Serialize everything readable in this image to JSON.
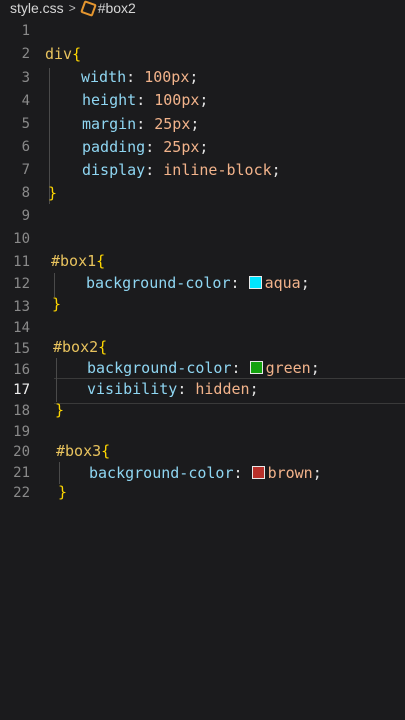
{
  "breadcrumb": {
    "file": "style.css",
    "separator": ">",
    "symbol": "#box2"
  },
  "gutter": [
    "1",
    "2",
    "3",
    "4",
    "5",
    "6",
    "7",
    "8",
    "9",
    "10",
    "11",
    "12",
    "13",
    "14",
    "15",
    "16",
    "17",
    "18",
    "19",
    "20",
    "21",
    "22"
  ],
  "active_line": "17",
  "code": {
    "l2": {
      "sel": "div",
      "brace": "{"
    },
    "l3": {
      "prop": "width",
      "colon": ": ",
      "val": "100px",
      "semi": ";"
    },
    "l4": {
      "prop": "height",
      "colon": ": ",
      "val": "100px",
      "semi": ";"
    },
    "l5": {
      "prop": "margin",
      "colon": ": ",
      "val": "25px",
      "semi": ";"
    },
    "l6": {
      "prop": "padding",
      "colon": ": ",
      "val": "25px",
      "semi": ";"
    },
    "l7": {
      "prop": "display",
      "colon": ": ",
      "val": "inline-block",
      "semi": ";"
    },
    "l8": {
      "brace": "}"
    },
    "l11": {
      "sel": "#box1",
      "brace": "{"
    },
    "l12": {
      "prop": "background-color",
      "colon": ": ",
      "val": "aqua",
      "semi": ";",
      "swatch": "#00e5ff"
    },
    "l13": {
      "brace": "}"
    },
    "l15": {
      "sel": "#box2",
      "brace": "{"
    },
    "l16": {
      "prop": "background-color",
      "colon": ": ",
      "val": "green",
      "semi": ";",
      "swatch": "#13a10e"
    },
    "l17": {
      "prop": "visibility",
      "colon": ": ",
      "val": "hidden",
      "semi": ";"
    },
    "l18": {
      "brace": "}"
    },
    "l20": {
      "sel": "#box3",
      "brace": "{"
    },
    "l21": {
      "prop": "background-color",
      "colon": ": ",
      "val": "brown",
      "semi": ";",
      "swatch": "#b7302a"
    },
    "l22": {
      "brace": "}"
    }
  }
}
